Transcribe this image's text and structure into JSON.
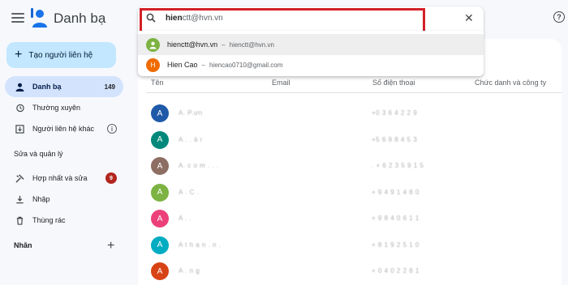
{
  "app": {
    "title": "Danh bạ"
  },
  "sidebar": {
    "create_label": "Tạo người liên hệ",
    "items": [
      {
        "label": "Danh bạ",
        "count": "149"
      },
      {
        "label": "Thường xuyên"
      },
      {
        "label": "Người liên hệ khác"
      }
    ],
    "manage_section": "Sửa và quản lý",
    "manage_items": [
      {
        "label": "Hợp nhất và sửa",
        "badge": "9"
      },
      {
        "label": "Nhập"
      },
      {
        "label": "Thùng rác"
      }
    ],
    "labels_section": "Nhãn"
  },
  "search": {
    "query_bold": "hien",
    "query_rest": "ctt@hvn.vn"
  },
  "suggestions": [
    {
      "initial": "",
      "name": "hienctt@hvn.vn",
      "email": "hienctt@hvn.vn",
      "color": "#7cb342"
    },
    {
      "initial": "H",
      "name": "Hien Cao",
      "email": "hiencao0710@gmail.com",
      "color": "#ef6c00"
    }
  ],
  "table": {
    "headers": [
      "Tên",
      "Email",
      "Số điện thoại",
      "Chức danh và công ty"
    ],
    "rows": [
      {
        "initial": "A",
        "color": "#1e5aa8",
        "name": "A. P.ưn",
        "phone": "+0 3 6 4 2 2 9"
      },
      {
        "initial": "A",
        "color": "#00897b",
        "name": "A . . ả r",
        "phone": "+5 6 9 8 4 5 3"
      },
      {
        "initial": "A",
        "color": "#8d6e63",
        "name": "A. c o m . . .",
        "phone": ". + 6 2 3 5 9 1 5"
      },
      {
        "initial": "A",
        "color": "#7cb342",
        "name": "A . C .",
        "phone": "+ 9 4 9 1 4 8 0"
      },
      {
        "initial": "A",
        "color": "#ec407a",
        "name": "A . .",
        "phone": "+ 9 8 4 0 6 1 1"
      },
      {
        "initial": "A",
        "color": "#00acc1",
        "name": "A t h a n . n .",
        "phone": "+ 8 1 9 2 5 1 0"
      },
      {
        "initial": "A",
        "color": "#d84315",
        "name": "A . n g",
        "phone": "+ 0 4 0 2 2 8 1"
      }
    ]
  },
  "colors": {
    "accent": "#c2e7ff",
    "active": "#d3e3fd",
    "highlight": "#d32027"
  }
}
